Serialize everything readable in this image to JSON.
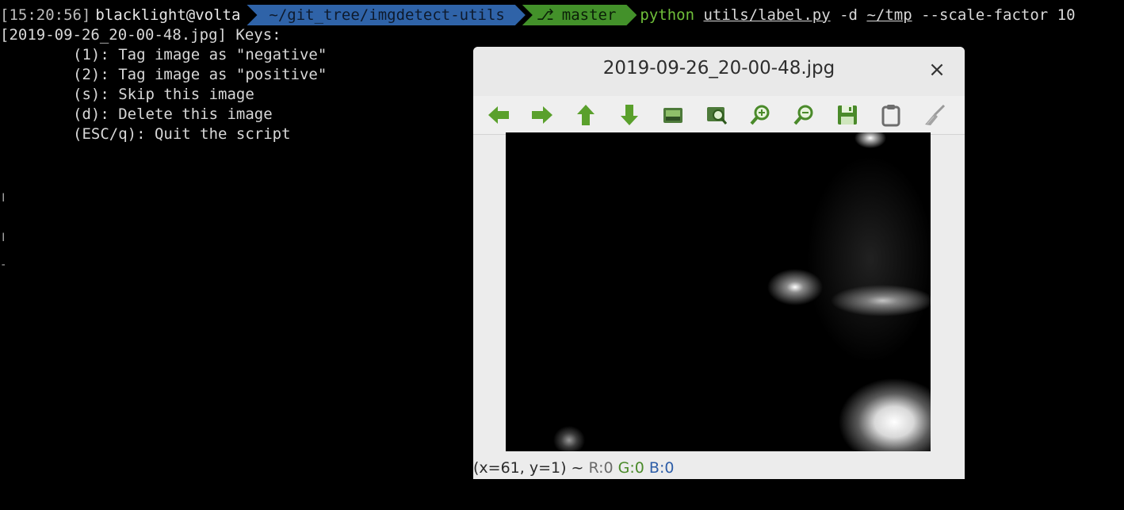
{
  "terminal": {
    "prompt": {
      "timestamp": "[15:20:56]",
      "user_host": "blacklight@volta",
      "path": "~/git_tree/imgdetect-utils",
      "branch": "master",
      "branch_icon": "git-branch-icon",
      "command_exe": "python",
      "command_script": "utils/label.py",
      "command_flag_d": "-d",
      "command_dir": "~/tmp",
      "command_rest": "--scale-factor 10"
    },
    "header_line": "[2019-09-26_20-00-48.jpg] Keys:",
    "keys": [
      "(1): Tag image as \"negative\"",
      "(2): Tag image as \"positive\"",
      "(s): Skip this image",
      "(d): Delete this image",
      "(ESC/q): Quit the script"
    ],
    "stray_marks": [
      "ǀ",
      "ǀ",
      "-"
    ]
  },
  "viewer": {
    "title": "2019-09-26_20-00-48.jpg",
    "close_glyph": "×",
    "toolbar": [
      {
        "name": "arrow-left-icon",
        "color": "#5aa02c"
      },
      {
        "name": "arrow-right-icon",
        "color": "#5aa02c"
      },
      {
        "name": "arrow-up-icon",
        "color": "#5aa02c"
      },
      {
        "name": "arrow-down-icon",
        "color": "#5aa02c"
      },
      {
        "name": "fit-image-icon",
        "color": "#5aa02c"
      },
      {
        "name": "zoom-fit-icon",
        "color": "#5aa02c"
      },
      {
        "name": "zoom-in-icon",
        "color": "#5aa02c"
      },
      {
        "name": "zoom-out-icon",
        "color": "#5aa02c"
      },
      {
        "name": "save-icon",
        "color": "#5aa02c"
      },
      {
        "name": "clipboard-icon",
        "color": "#7a7a7a"
      },
      {
        "name": "brush-icon",
        "color": "#8a8a8a"
      }
    ],
    "status": {
      "coords": "(x=61, y=1) ~ ",
      "r": "R:0",
      "g": "G:0",
      "b": "B:0"
    }
  },
  "colors": {
    "terminal_bg": "#000000",
    "path_segment": "#2f63a8",
    "branch_segment": "#43912a",
    "exe": "#6fbf3a"
  }
}
